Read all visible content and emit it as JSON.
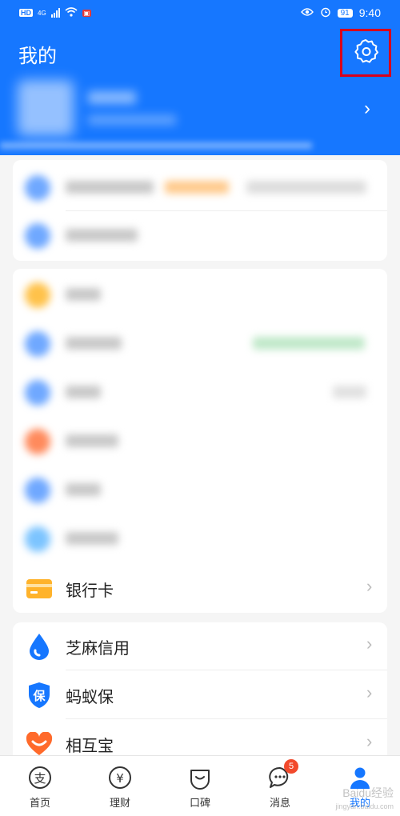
{
  "status_bar": {
    "network_label": "HD",
    "network_gen": "4G",
    "battery": "91",
    "time": "9:40"
  },
  "header": {
    "title": "我的"
  },
  "menu": {
    "bank_card": "银行卡",
    "sesame_credit": "芝麻信用",
    "ant_insurance": "蚂蚁保",
    "xianghubao": "相互宝"
  },
  "tabbar": {
    "tabs": [
      {
        "label": "首页",
        "icon": "alipay-home-icon"
      },
      {
        "label": "理财",
        "icon": "yuan-icon"
      },
      {
        "label": "口碑",
        "icon": "smile-bag-icon"
      },
      {
        "label": "消息",
        "icon": "chat-bubble-icon",
        "badge": "5"
      },
      {
        "label": "我的",
        "icon": "person-icon"
      }
    ]
  },
  "watermark": {
    "text": "Baidu经验",
    "sub": "jingyan.baidu.com"
  },
  "colors": {
    "brand_blue": "#1677ff",
    "highlight_red": "#d9001b",
    "card_yellow": "#ffb32b",
    "badge_red": "#f24a2c"
  }
}
